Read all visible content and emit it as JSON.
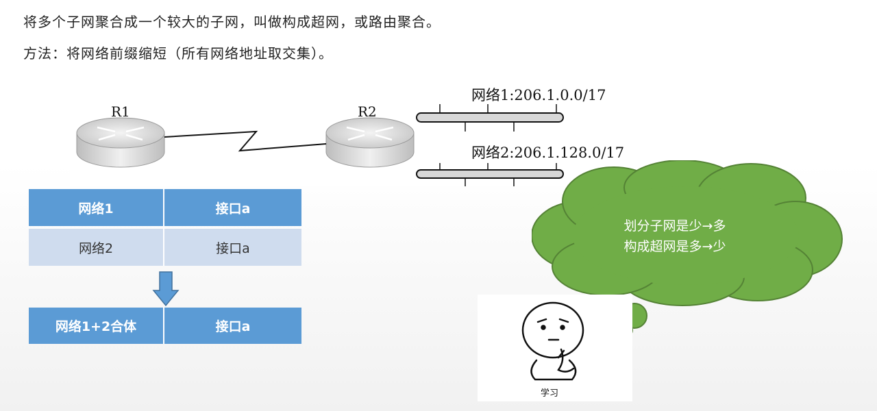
{
  "header": {
    "line1": "将多个子网聚合成一个较大的子网，叫做构成超网，或路由聚合。",
    "line2": "方法：将网络前缀缩短（所有网络地址取交集）。"
  },
  "diagram": {
    "router1": "R1",
    "router2": "R2",
    "net1": "网络1:206.1.0.0/17",
    "net2": "网络2:206.1.128.0/17"
  },
  "table_before": {
    "header": [
      "网络1",
      "接口a"
    ],
    "row": [
      "网络2",
      "接口a"
    ]
  },
  "table_after": {
    "row": [
      "网络1+2合体",
      "接口a"
    ]
  },
  "bubble": {
    "line1": "划分子网是少→多",
    "line2": "构成超网是多→少"
  },
  "person_label": "学习",
  "colors": {
    "table_header": "#5b9bd5",
    "table_row": "#cfdcee",
    "cloud": "#70ad47",
    "arrow": "#5b9bd5"
  }
}
